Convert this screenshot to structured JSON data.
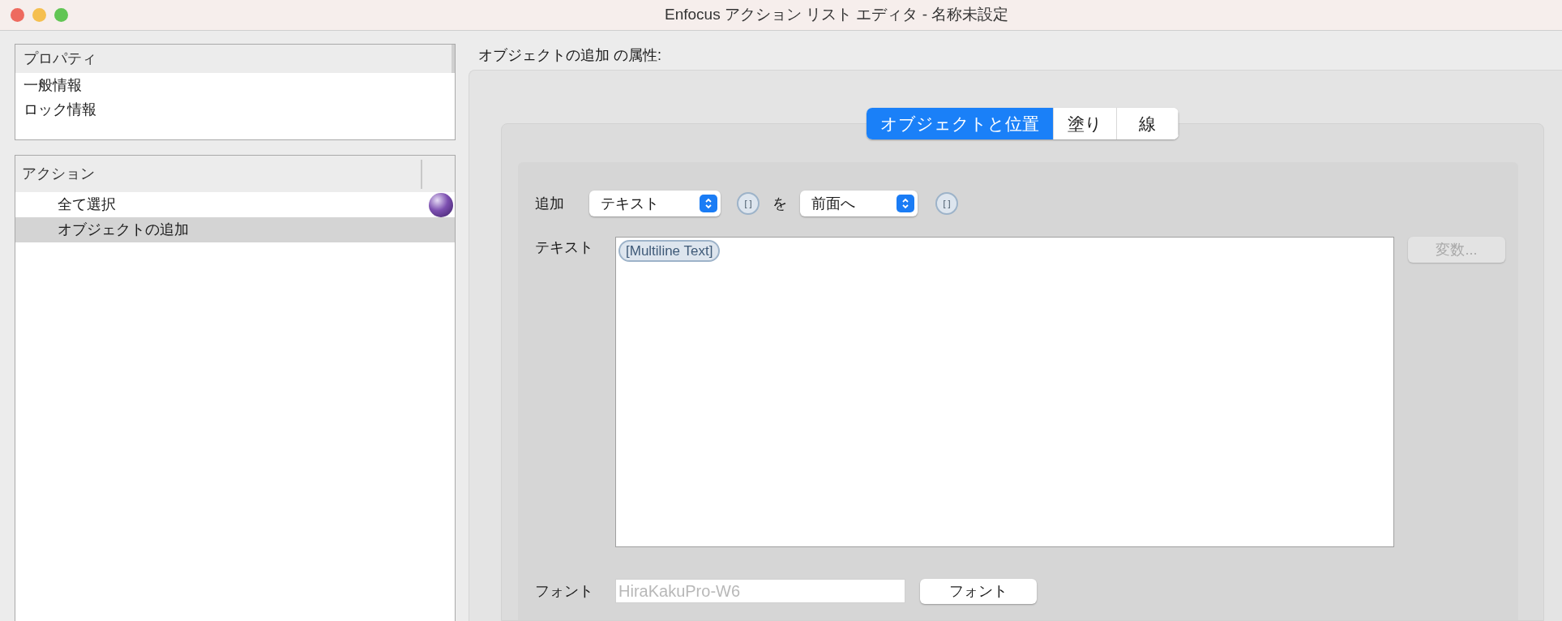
{
  "window": {
    "title": "Enfocus アクション リスト エディタ - 名称未設定"
  },
  "properties": {
    "header": "プロパティ",
    "items": [
      {
        "label": "一般情報",
        "selected": false
      },
      {
        "label": "ロック情報",
        "selected": false
      }
    ]
  },
  "actions": {
    "header": "アクション",
    "items": [
      {
        "label": "全て選択",
        "selected": false,
        "marked": true
      },
      {
        "label": "オブジェクトの追加",
        "selected": true,
        "marked": false
      }
    ]
  },
  "attributes": {
    "title": "オブジェクトの追加 の属性:",
    "tabs": [
      {
        "label": "オブジェクトと位置",
        "selected": true
      },
      {
        "label": "塗り",
        "selected": false
      },
      {
        "label": "線",
        "selected": false
      }
    ],
    "add_label": "追加",
    "add_select": "テキスト",
    "add_variable": "[ ]",
    "connector": "を",
    "position_select": "前面へ",
    "position_variable": "[ ]",
    "text_label": "テキスト",
    "text_token": "[Multiline Text]",
    "variables_button": {
      "label": "変数...",
      "disabled": true
    },
    "font_label": "フォント",
    "font_field": {
      "value": "HiraKakuPro-W6",
      "disabled": true
    },
    "font_button": "フォント"
  }
}
